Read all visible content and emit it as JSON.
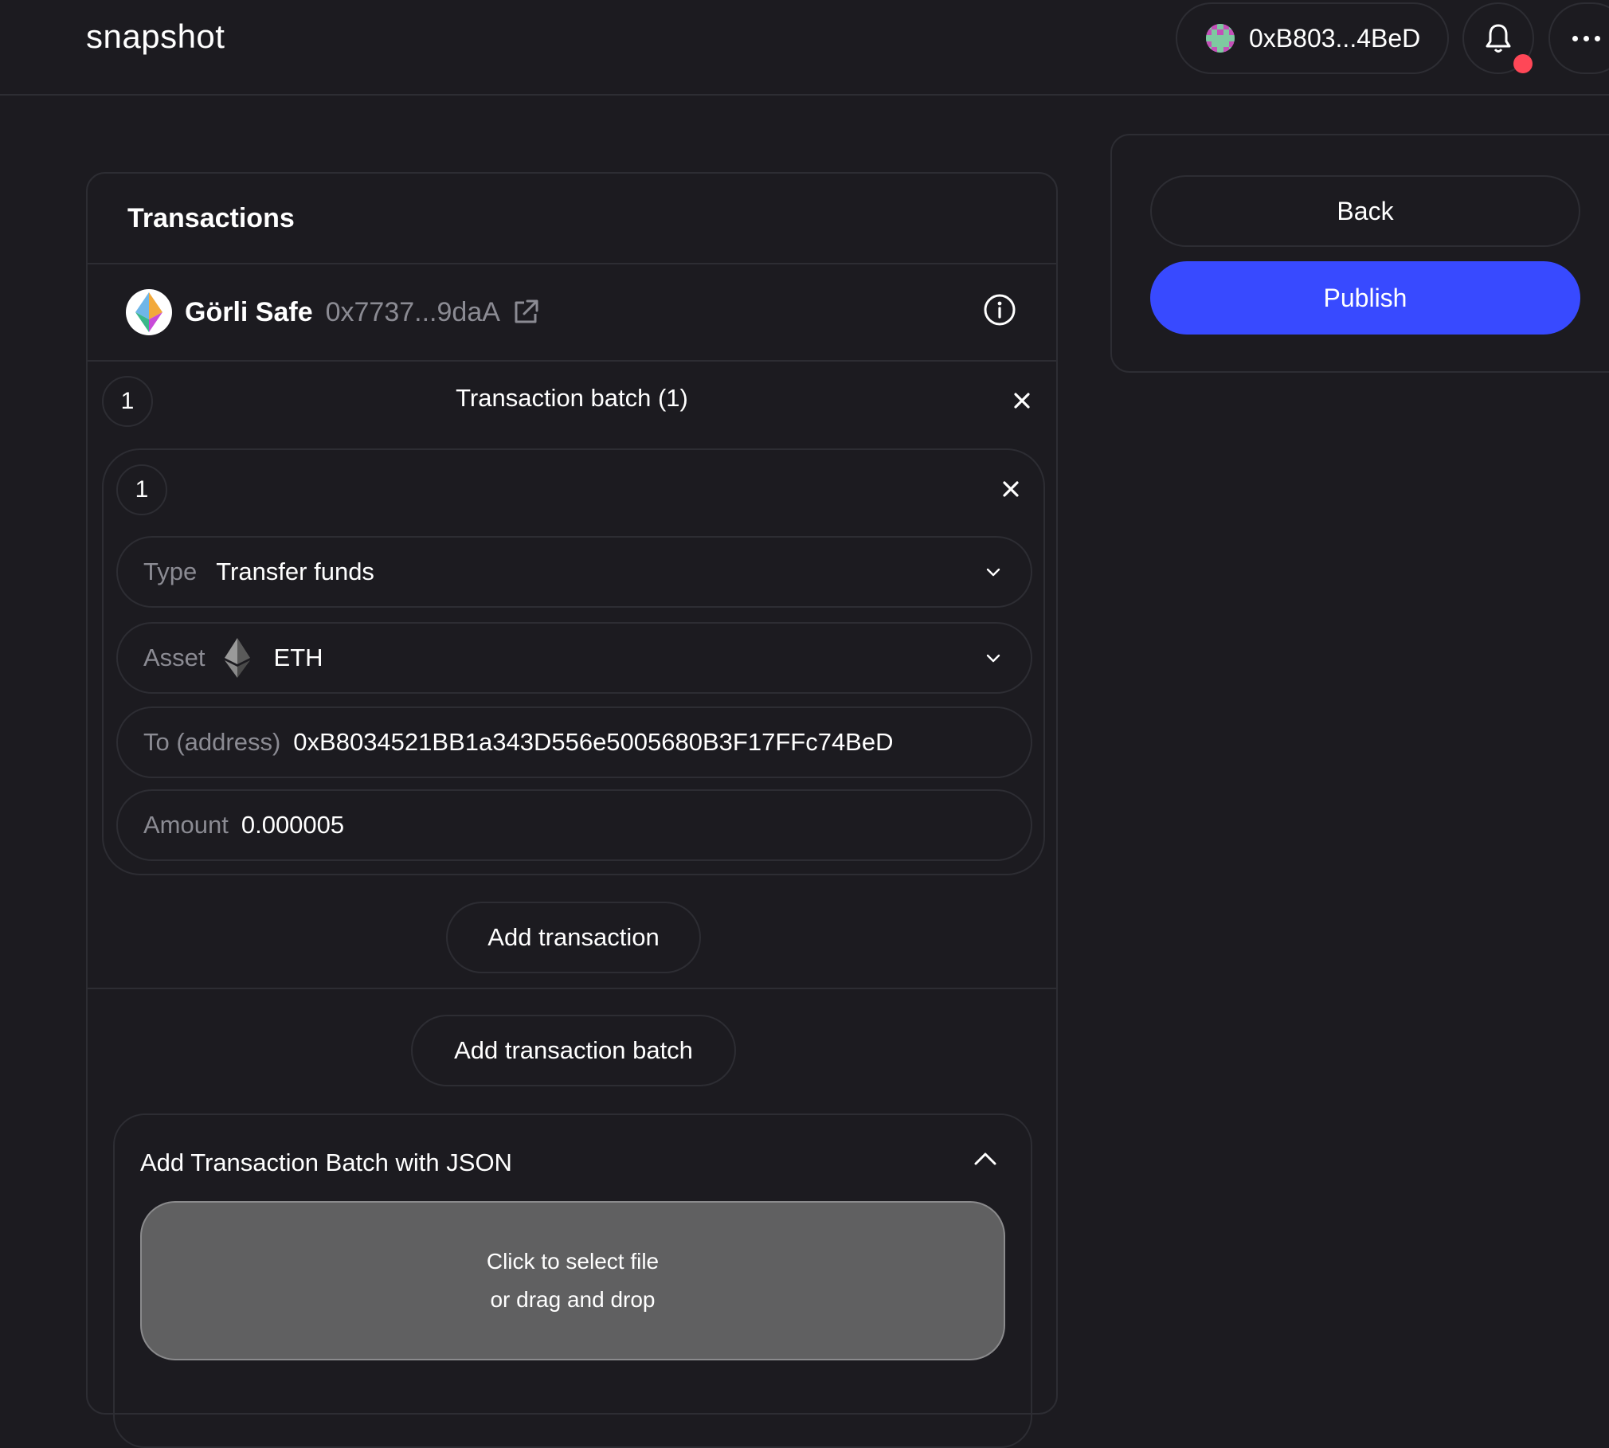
{
  "header": {
    "brand": "snapshot",
    "account": "0xB803...4BeD",
    "notification_dot_color": "#ff4757",
    "icons": [
      "bell-icon",
      "more-icon"
    ]
  },
  "transactions": {
    "title": "Transactions",
    "safe": {
      "name": "Görli Safe",
      "address": "0x7737...9daA",
      "icons": [
        "ethereum-logo-icon",
        "external-link-icon",
        "info-icon"
      ]
    },
    "batch": {
      "number": "1",
      "title": "Transaction batch (1)",
      "transaction": {
        "number": "1",
        "type_label": "Type",
        "type_value": "Transfer funds",
        "asset_label": "Asset",
        "asset_value": "ETH",
        "to_label": "To (address)",
        "to_value": "0xB8034521BB1a343D556e5005680B3F17FFc74BeD",
        "amount_label": "Amount",
        "amount_value": "0.000005"
      },
      "add_transaction_label": "Add transaction"
    },
    "add_batch_label": "Add transaction batch",
    "json_section": {
      "title": "Add Transaction Batch with JSON",
      "dropzone_line1": "Click to select file",
      "dropzone_line2": "or drag and drop"
    }
  },
  "sidebar": {
    "back_label": "Back",
    "publish_label": "Publish",
    "accent_color": "#384aff"
  }
}
